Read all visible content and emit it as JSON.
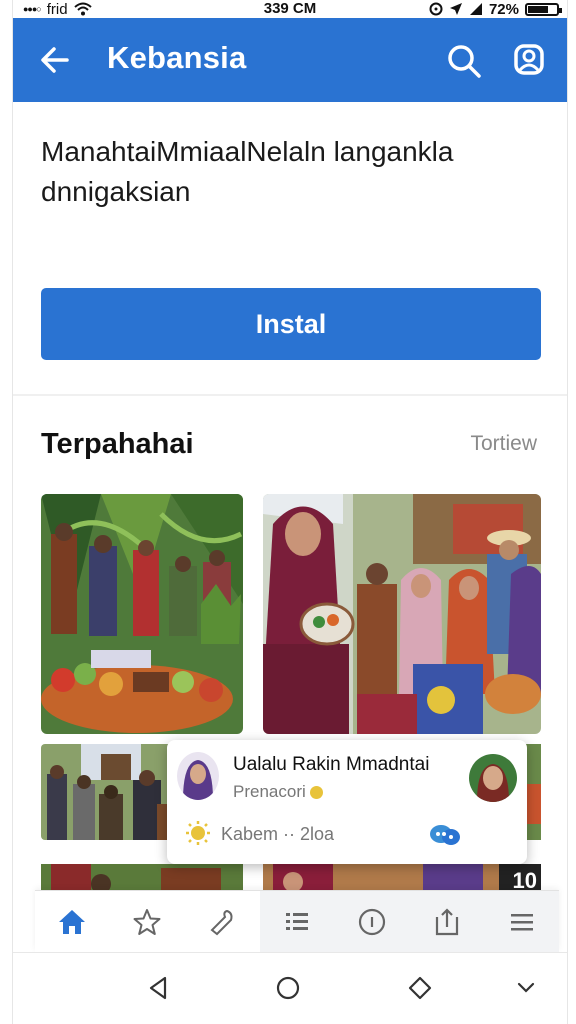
{
  "status_bar": {
    "carrier": "frid",
    "time": "339 CM",
    "battery_text": "72%",
    "battery_level": 0.72
  },
  "app_bar": {
    "title": "Kebansia",
    "color": "#2a73d2"
  },
  "description": {
    "line1": "ManahtaiMmiaalNelaln langankla",
    "line2": "dnnigaksian"
  },
  "install_button": {
    "label": "Instal"
  },
  "section": {
    "title": "Terpahahai",
    "link": "Tortiew"
  },
  "card": {
    "name": "Ualalu Rakin Mmadntai",
    "subtitle": "Prenacori",
    "meta": "Kabem ·· 2loa"
  },
  "overlay_badge": "10",
  "tabs": [
    {
      "name": "home",
      "icon": "home-icon",
      "active": true
    },
    {
      "name": "favorite",
      "icon": "star-icon",
      "active": false
    },
    {
      "name": "tools",
      "icon": "wrench-icon",
      "active": false
    },
    {
      "name": "list",
      "icon": "list-icon",
      "active": false
    },
    {
      "name": "info",
      "icon": "circle-icon",
      "active": false
    },
    {
      "name": "share",
      "icon": "share-icon",
      "active": false
    },
    {
      "name": "menu",
      "icon": "menu-icon",
      "active": false
    }
  ],
  "colors": {
    "accent": "#2a73d2",
    "text": "#111111",
    "muted": "#8a8a8a"
  }
}
